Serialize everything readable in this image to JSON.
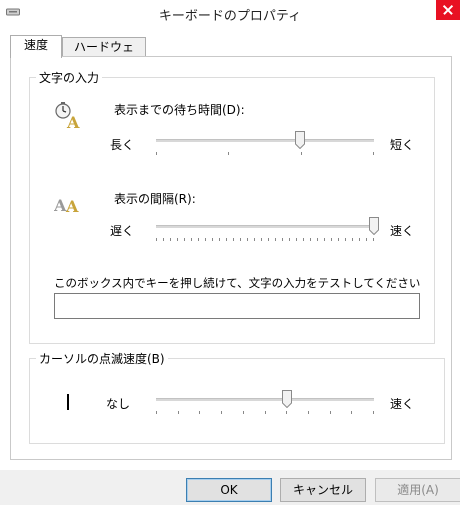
{
  "window": {
    "title": "キーボードのプロパティ"
  },
  "tabs": [
    {
      "label": "速度"
    },
    {
      "label": "ハードウェア"
    }
  ],
  "char_input": {
    "group_label": "文字の入力",
    "delay": {
      "label": "表示までの待ち時間(D):",
      "min_label": "長く",
      "max_label": "短く",
      "level": 0.66
    },
    "rate": {
      "label": "表示の間隔(R):",
      "min_label": "遅く",
      "max_label": "速く",
      "level": 1.0
    },
    "test_label": "このボックス内でキーを押し続けて、文字の入力をテストしてください(T):",
    "test_value": ""
  },
  "cursor": {
    "group_label": "カーソルの点滅速度(B)",
    "min_label": "なし",
    "max_label": "速く",
    "level": 0.6
  },
  "buttons": {
    "ok": "OK",
    "cancel": "キャンセル",
    "apply": "適用(A)"
  }
}
